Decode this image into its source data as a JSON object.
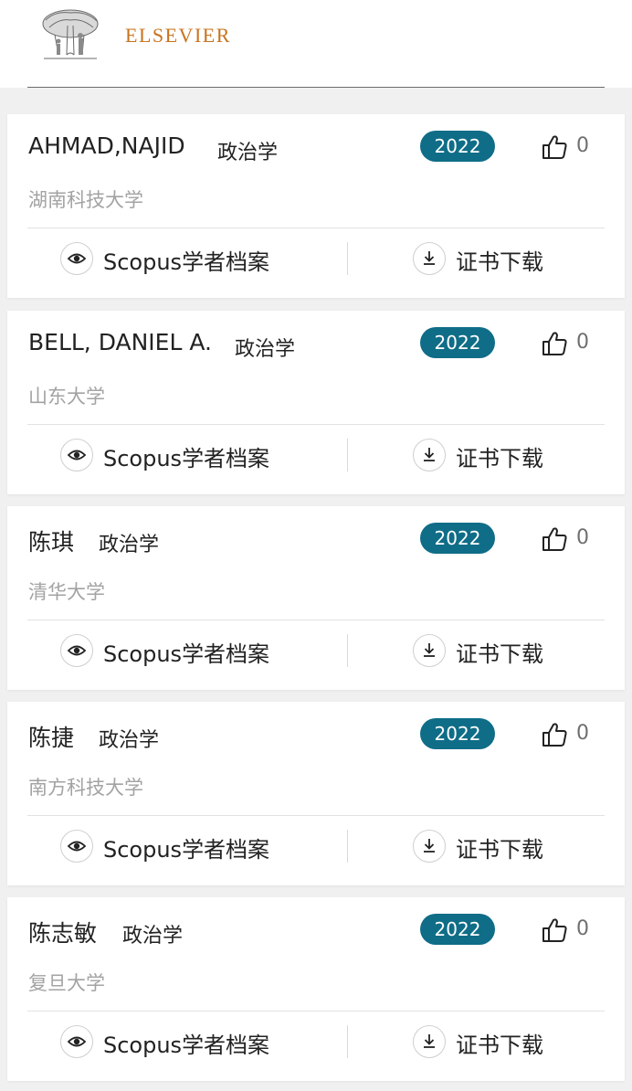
{
  "header": {
    "brand": "ELSEVIER"
  },
  "colors": {
    "brand_orange": "#c8731d",
    "badge_teal": "#0f6d87",
    "muted_text": "#a3a3a3"
  },
  "icons": {
    "logo": "elsevier-tree-logo",
    "like": "thumbs-up-icon",
    "view": "eye-icon",
    "download": "download-icon"
  },
  "cards": [
    {
      "name": "AHMAD,NAJID",
      "subject": "政治学",
      "university": "湖南科技大学",
      "year": "2022",
      "likes": "0",
      "scopus_label": "Scopus学者档案",
      "cert_label": "证书下载"
    },
    {
      "name": "BELL, DANIEL A.",
      "subject": "政治学",
      "university": "山东大学",
      "year": "2022",
      "likes": "0",
      "scopus_label": "Scopus学者档案",
      "cert_label": "证书下载"
    },
    {
      "name": "陈琪",
      "subject": "政治学",
      "university": "清华大学",
      "year": "2022",
      "likes": "0",
      "scopus_label": "Scopus学者档案",
      "cert_label": "证书下载"
    },
    {
      "name": "陈捷",
      "subject": "政治学",
      "university": "南方科技大学",
      "year": "2022",
      "likes": "0",
      "scopus_label": "Scopus学者档案",
      "cert_label": "证书下载"
    },
    {
      "name": "陈志敏",
      "subject": "政治学",
      "university": "复旦大学",
      "year": "2022",
      "likes": "0",
      "scopus_label": "Scopus学者档案",
      "cert_label": "证书下载"
    }
  ]
}
